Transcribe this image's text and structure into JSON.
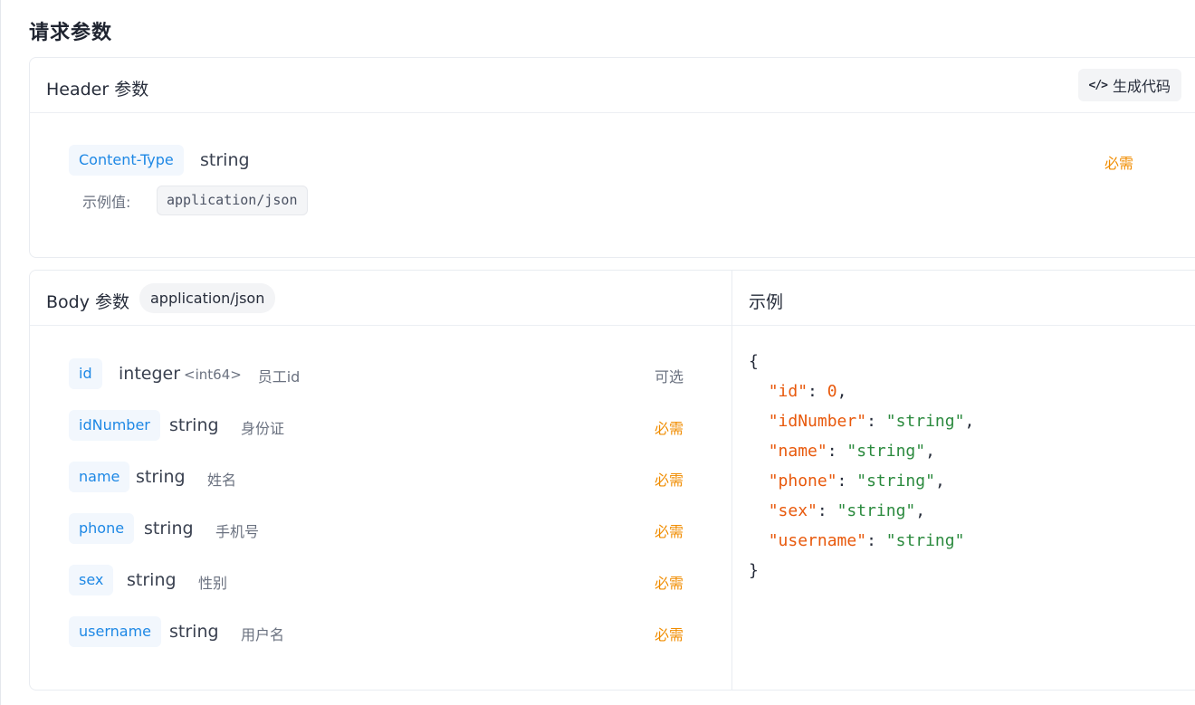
{
  "section_title": "请求参数",
  "header_section": {
    "title": "Header 参数",
    "generate_button": "生成代码",
    "param": {
      "name": "Content-Type",
      "type": "string",
      "required_label": "必需",
      "example_label": "示例值:",
      "example_value": "application/json"
    }
  },
  "body_section": {
    "title": "Body 参数",
    "media_type": "application/json",
    "params": [
      {
        "name": "id",
        "type": "integer",
        "format": "<int64>",
        "desc": "员工id",
        "flag": "可选"
      },
      {
        "name": "idNumber",
        "type": "string",
        "format": "",
        "desc": "身份证",
        "flag": "必需"
      },
      {
        "name": "name",
        "type": "string",
        "format": "",
        "desc": "姓名",
        "flag": "必需"
      },
      {
        "name": "phone",
        "type": "string",
        "format": "",
        "desc": "手机号",
        "flag": "必需"
      },
      {
        "name": "sex",
        "type": "string",
        "format": "",
        "desc": "性别",
        "flag": "必需"
      },
      {
        "name": "username",
        "type": "string",
        "format": "",
        "desc": "用户名",
        "flag": "必需"
      }
    ]
  },
  "example_section": {
    "title": "示例",
    "open_brace": "{",
    "close_brace": "}",
    "lines": [
      {
        "key": "\"id\"",
        "value": "0",
        "value_kind": "number",
        "comma": ","
      },
      {
        "key": "\"idNumber\"",
        "value": "\"string\"",
        "value_kind": "string",
        "comma": ","
      },
      {
        "key": "\"name\"",
        "value": "\"string\"",
        "value_kind": "string",
        "comma": ","
      },
      {
        "key": "\"phone\"",
        "value": "\"string\"",
        "value_kind": "string",
        "comma": ","
      },
      {
        "key": "\"sex\"",
        "value": "\"string\"",
        "value_kind": "string",
        "comma": ","
      },
      {
        "key": "\"username\"",
        "value": "\"string\"",
        "value_kind": "string",
        "comma": ""
      }
    ]
  },
  "colors": {
    "tag_text": "#1e88e5",
    "required": "#f08c00",
    "json_key": "#e8590c",
    "json_string": "#2b8a3e"
  }
}
